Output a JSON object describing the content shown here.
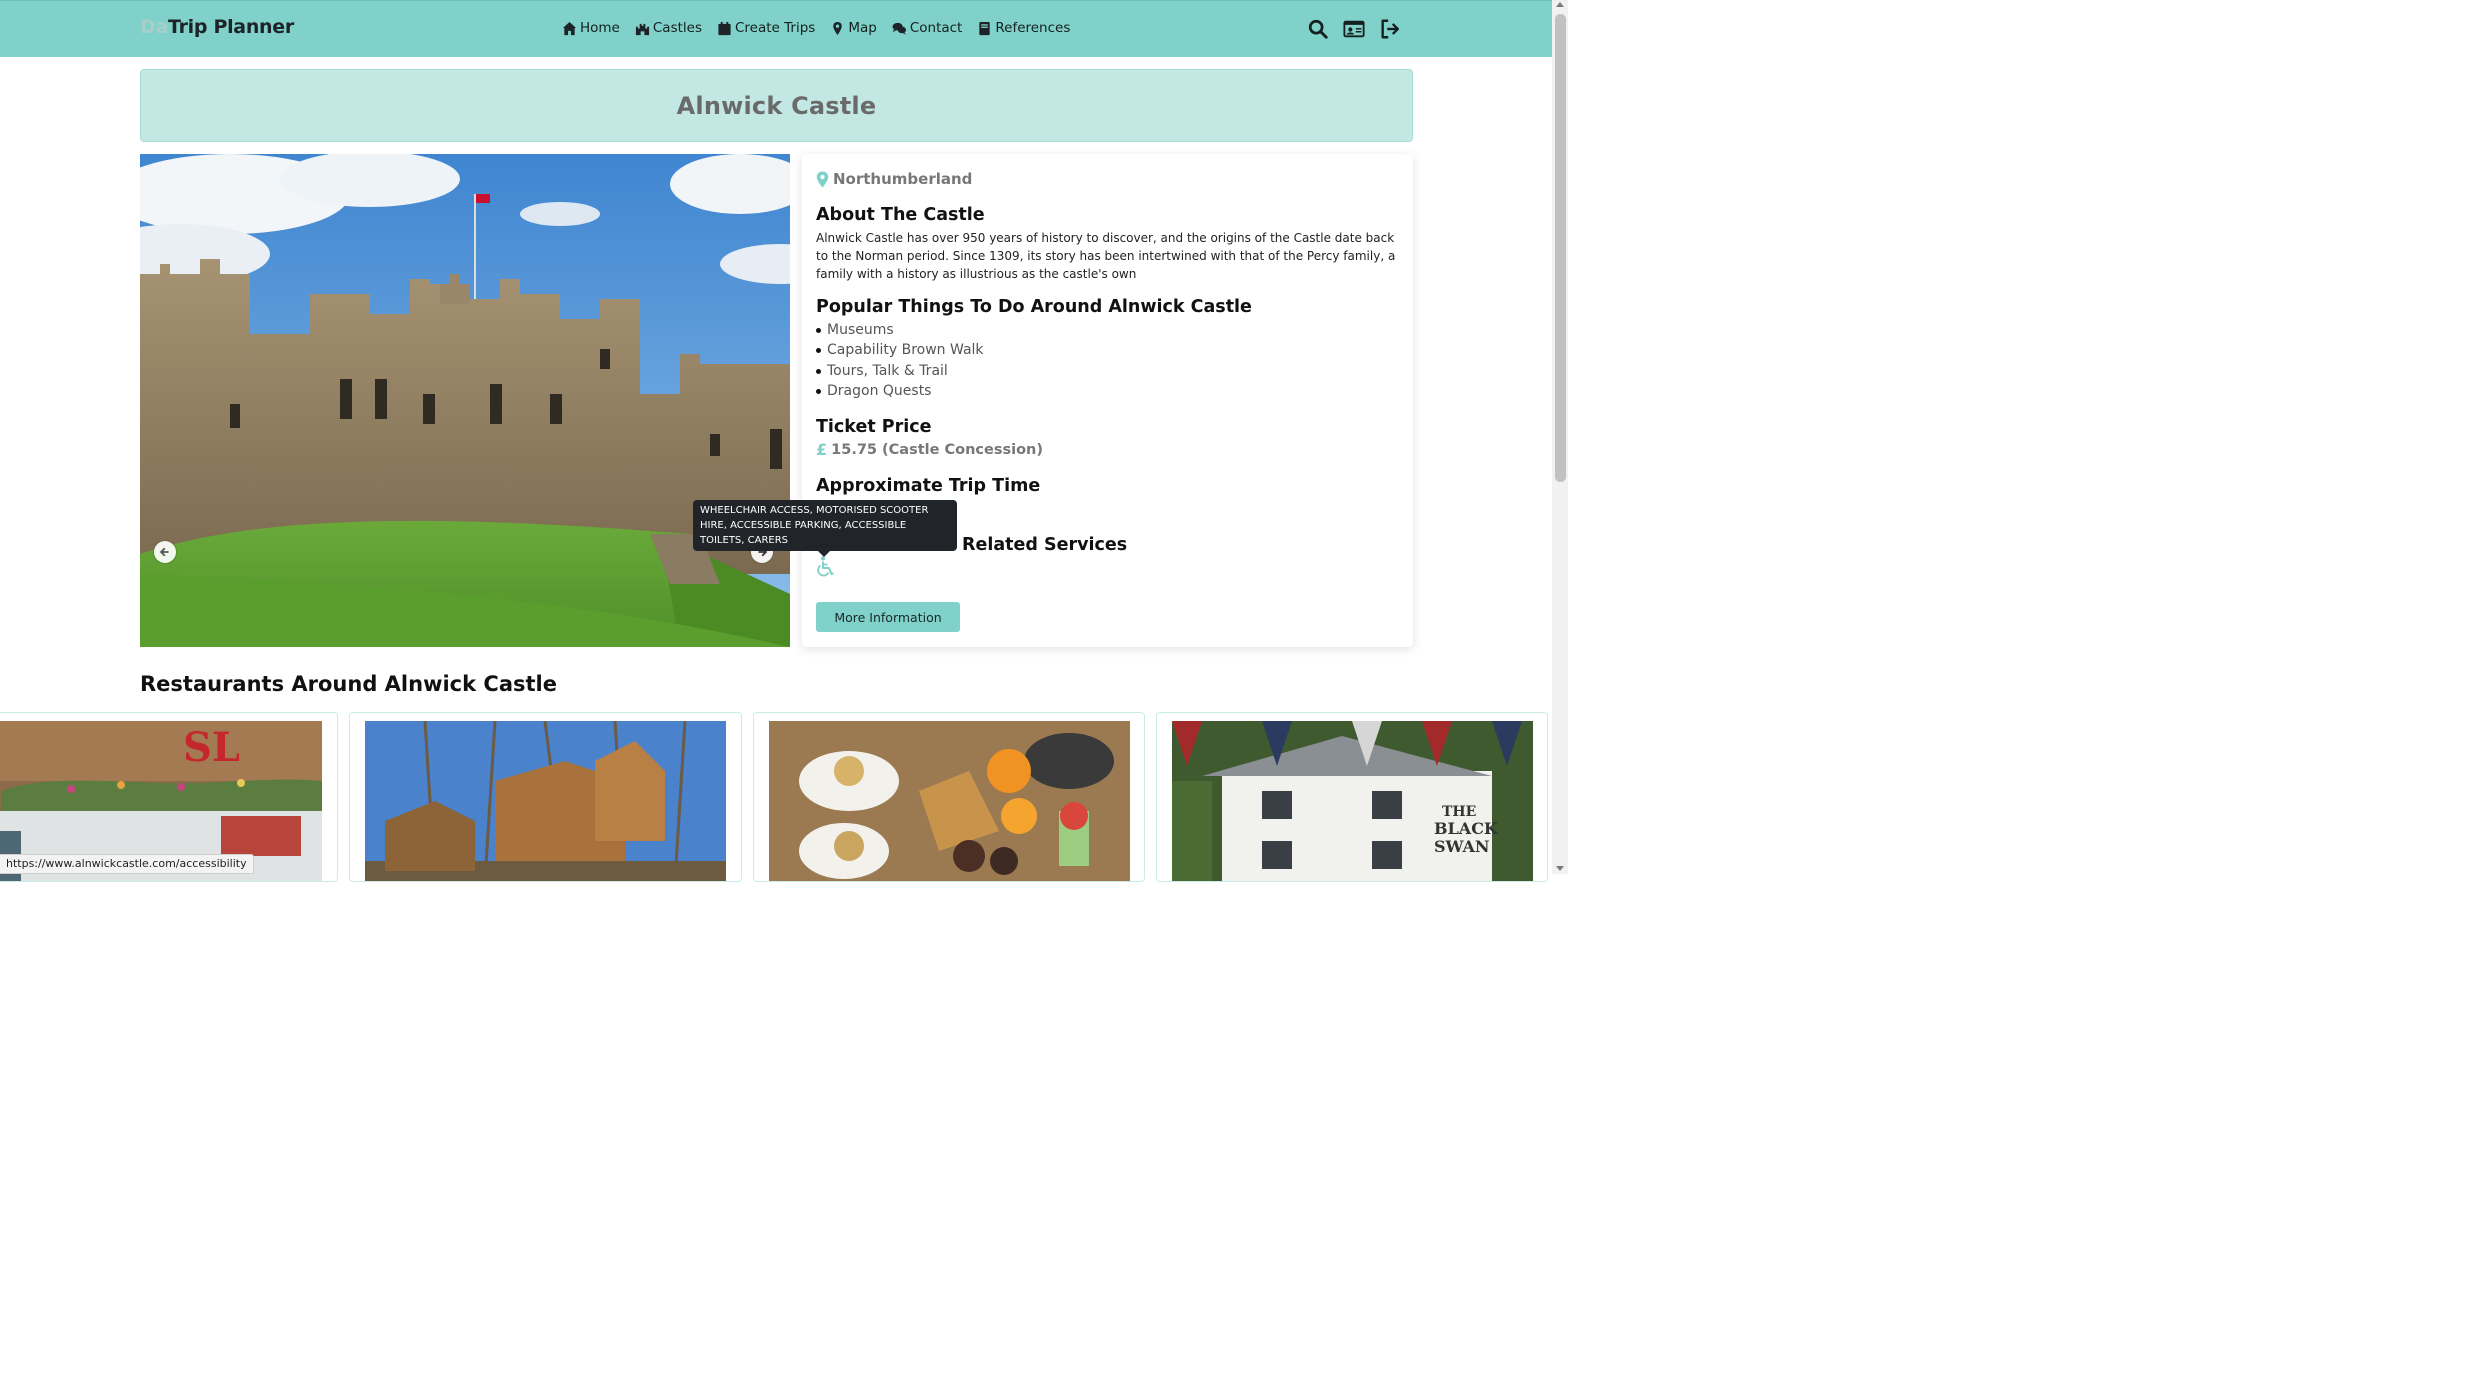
{
  "navbar": {
    "brand_prefix": "Da",
    "brand_main": "Trip Planner",
    "links": [
      {
        "label": "Home",
        "icon": "home-icon"
      },
      {
        "label": "Castles",
        "icon": "castle-icon"
      },
      {
        "label": "Create Trips",
        "icon": "calendar-icon"
      },
      {
        "label": "Map",
        "icon": "map-marker-icon"
      },
      {
        "label": "Contact",
        "icon": "comments-icon"
      },
      {
        "label": "References",
        "icon": "book-icon"
      }
    ],
    "right_icons": [
      "search-icon",
      "id-card-icon",
      "sign-out-icon"
    ]
  },
  "castle": {
    "title": "Alnwick Castle",
    "location": "Northumberland",
    "about_heading": "About The Castle",
    "about_text": "Alnwick Castle has over 950 years of history to discover, and the origins of the Castle date back to the Norman period. Since 1309, its story has been intertwined with that of the Percy family, a family with a history as illustrious as the castle's own",
    "things_heading": "Popular Things To Do Around Alnwick Castle",
    "things": [
      "Museums",
      "Capability Brown Walk",
      "Tours, Talk & Trail",
      "Dragon Quests"
    ],
    "ticket_heading": "Ticket Price",
    "ticket_currency": "£",
    "ticket_amount": "15.75",
    "ticket_note": "(Castle Concession)",
    "trip_time_heading": "Approximate Trip Time",
    "services_heading_visible": "Related Services",
    "accessibility_icon": "wheelchair-icon",
    "tooltip": "WHEELCHAIR ACCESS, MOTORISED SCOOTER HIRE, ACCESSIBLE PARKING, ACCESSIBLE TOILETS, CARERS",
    "more_button": "More Information"
  },
  "carousel": {
    "prev_icon": "arrow-left-icon",
    "next_icon": "arrow-right-icon"
  },
  "restaurants": {
    "heading": "Restaurants Around Alnwick Castle"
  },
  "status_bar": {
    "url": "https://www.alnwickcastle.com/accessibility"
  },
  "colors": {
    "accent": "#7fd1c9",
    "title_bg": "#c3e8e4",
    "tooltip_bg": "#212529"
  }
}
